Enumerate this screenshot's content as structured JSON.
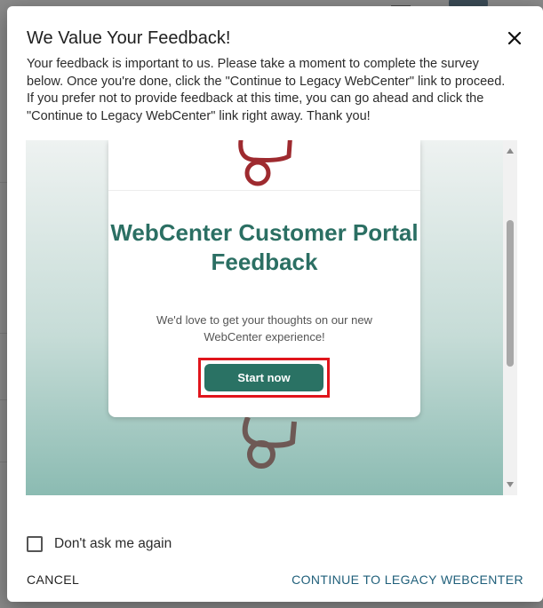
{
  "dialog": {
    "title": "We Value Your Feedback!",
    "close_icon": "close-icon",
    "intro": "Your feedback is important to us. Please take a moment to complete the survey below. Once you're done, click the \"Continue to Legacy WebCenter\" link to proceed. If you prefer not to provide feedback at this time, you can go ahead and click the \"Continue to Legacy WebCenter\" link right away. Thank you!"
  },
  "survey": {
    "title": "WebCenter Customer Portal Feedback",
    "description": "We'd love to get your thoughts on our new WebCenter experience!",
    "start_button": "Start now",
    "highlight_color": "#e0151c",
    "accent_color": "#2a7264"
  },
  "footer": {
    "dont_ask_label": "Don't ask me again",
    "dont_ask_checked": false,
    "cancel_label": "CANCEL",
    "continue_label": "CONTINUE TO LEGACY WEBCENTER"
  }
}
